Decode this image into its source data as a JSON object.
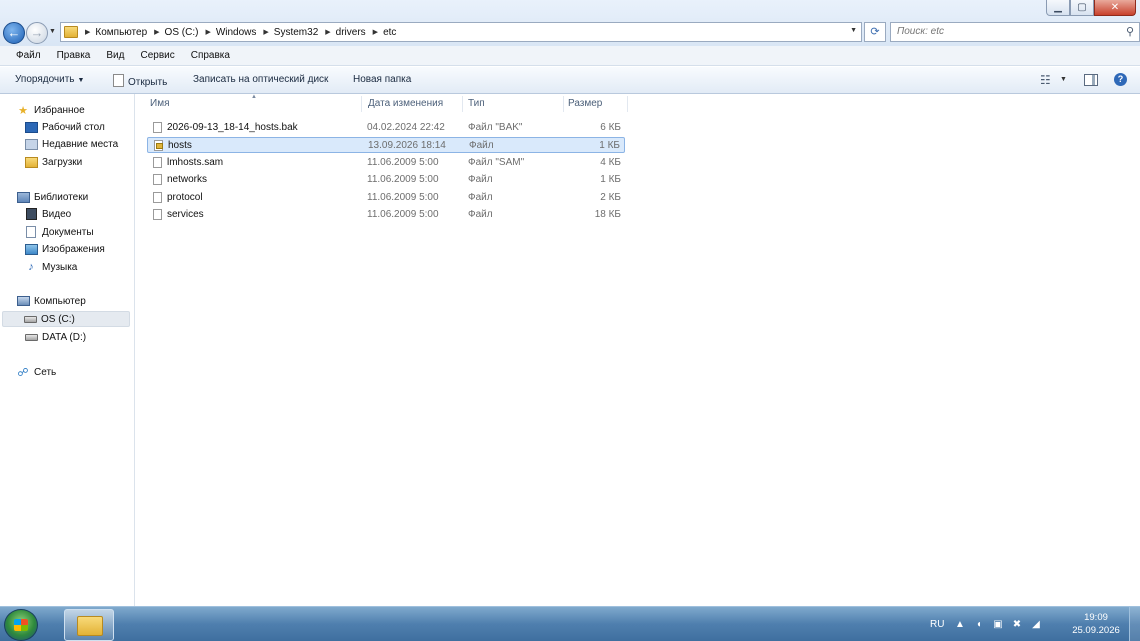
{
  "window": {
    "min_glyph": "▁",
    "max_glyph": "▢",
    "close_glyph": "✕"
  },
  "nav": {
    "back_glyph": "←",
    "forward_glyph": "→"
  },
  "address": {
    "crumbs": [
      "Компьютер",
      "OS (C:)",
      "Windows",
      "System32",
      "drivers",
      "etc"
    ]
  },
  "search": {
    "placeholder": "Поиск: etc"
  },
  "menubar": {
    "items": [
      "Файл",
      "Правка",
      "Вид",
      "Сервис",
      "Справка"
    ]
  },
  "toolbar": {
    "organize": "Упорядочить",
    "open": "Открыть",
    "burn": "Записать на оптический диск",
    "new_folder": "Новая папка",
    "help_glyph": "?"
  },
  "navpane": {
    "favorites": {
      "title": "Избранное",
      "items": [
        "Рабочий стол",
        "Недавние места",
        "Загрузки"
      ]
    },
    "libraries": {
      "title": "Библиотеки",
      "items": [
        "Видео",
        "Документы",
        "Изображения",
        "Музыка"
      ]
    },
    "computer": {
      "title": "Компьютер",
      "items": [
        "OS (C:)",
        "DATA (D:)"
      ],
      "selected": "OS (C:)"
    },
    "network": {
      "title": "Сеть"
    }
  },
  "filelist": {
    "columns": [
      "Имя",
      "Дата изменения",
      "Тип",
      "Размер"
    ],
    "selected": "hosts",
    "rows": [
      {
        "name": "2026-09-13_18-14_hosts.bak",
        "date": "04.02.2024 22:42",
        "type": "Файл \"BAK\"",
        "size": "6 КБ"
      },
      {
        "name": "hosts",
        "date": "13.09.2026 18:14",
        "type": "Файл",
        "size": "1 КБ"
      },
      {
        "name": "lmhosts.sam",
        "date": "11.06.2009 5:00",
        "type": "Файл \"SAM\"",
        "size": "4 КБ"
      },
      {
        "name": "networks",
        "date": "11.06.2009 5:00",
        "type": "Файл",
        "size": "1 КБ"
      },
      {
        "name": "protocol",
        "date": "11.06.2009 5:00",
        "type": "Файл",
        "size": "2 КБ"
      },
      {
        "name": "services",
        "date": "11.06.2009 5:00",
        "type": "Файл",
        "size": "18 КБ"
      }
    ]
  },
  "taskbar": {
    "language": "RU",
    "time": "19:09",
    "date": "25.09.2026"
  }
}
